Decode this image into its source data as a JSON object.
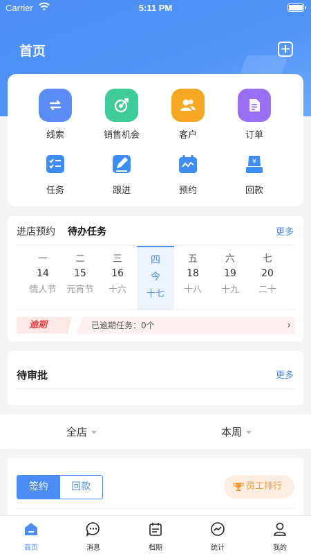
{
  "status_bar": {
    "carrier": "Carrier",
    "time": "5:11 PM"
  },
  "header": {
    "title": "首页"
  },
  "quick_actions": [
    {
      "label": "线索",
      "icon": "swap-icon",
      "color": "#5b8bf5"
    },
    {
      "label": "销售机会",
      "icon": "target-icon",
      "color": "#3ecb98"
    },
    {
      "label": "客户",
      "icon": "customers-icon",
      "color": "#f5a623"
    },
    {
      "label": "订单",
      "icon": "order-icon",
      "color": "#9b6cf4"
    },
    {
      "label": "任务",
      "icon": "task-icon",
      "color": "#3d8df5"
    },
    {
      "label": "跟进",
      "icon": "followup-icon",
      "color": "#3d8df5"
    },
    {
      "label": "预约",
      "icon": "appointment-icon",
      "color": "#3d8df5"
    },
    {
      "label": "回款",
      "icon": "payment-icon",
      "color": "#3d8df5"
    }
  ],
  "task_panel": {
    "tab_visit": "进店预约",
    "tab_todo": "待办任务",
    "more": "更多",
    "days": [
      {
        "week": "一",
        "num": "14",
        "lunar": "情人节"
      },
      {
        "week": "二",
        "num": "15",
        "lunar": "元宵节"
      },
      {
        "week": "三",
        "num": "16",
        "lunar": "十六"
      },
      {
        "week": "四",
        "num": "今",
        "lunar": "十七",
        "today": true
      },
      {
        "week": "五",
        "num": "18",
        "lunar": "十八"
      },
      {
        "week": "六",
        "num": "19",
        "lunar": "十九"
      },
      {
        "week": "七",
        "num": "20",
        "lunar": "二十"
      }
    ],
    "overdue_tag": "逾期",
    "overdue_text": "已逾期任务：0个"
  },
  "approval": {
    "title": "待审批",
    "more": "更多"
  },
  "filters": {
    "store": "全店",
    "period": "本周"
  },
  "stats": {
    "tab_sign": "签约",
    "tab_payment": "回款",
    "rank_label": "员工排行"
  },
  "tabbar": [
    {
      "label": "首页",
      "active": true
    },
    {
      "label": "消息"
    },
    {
      "label": "档期"
    },
    {
      "label": "统计"
    },
    {
      "label": "我的"
    }
  ]
}
